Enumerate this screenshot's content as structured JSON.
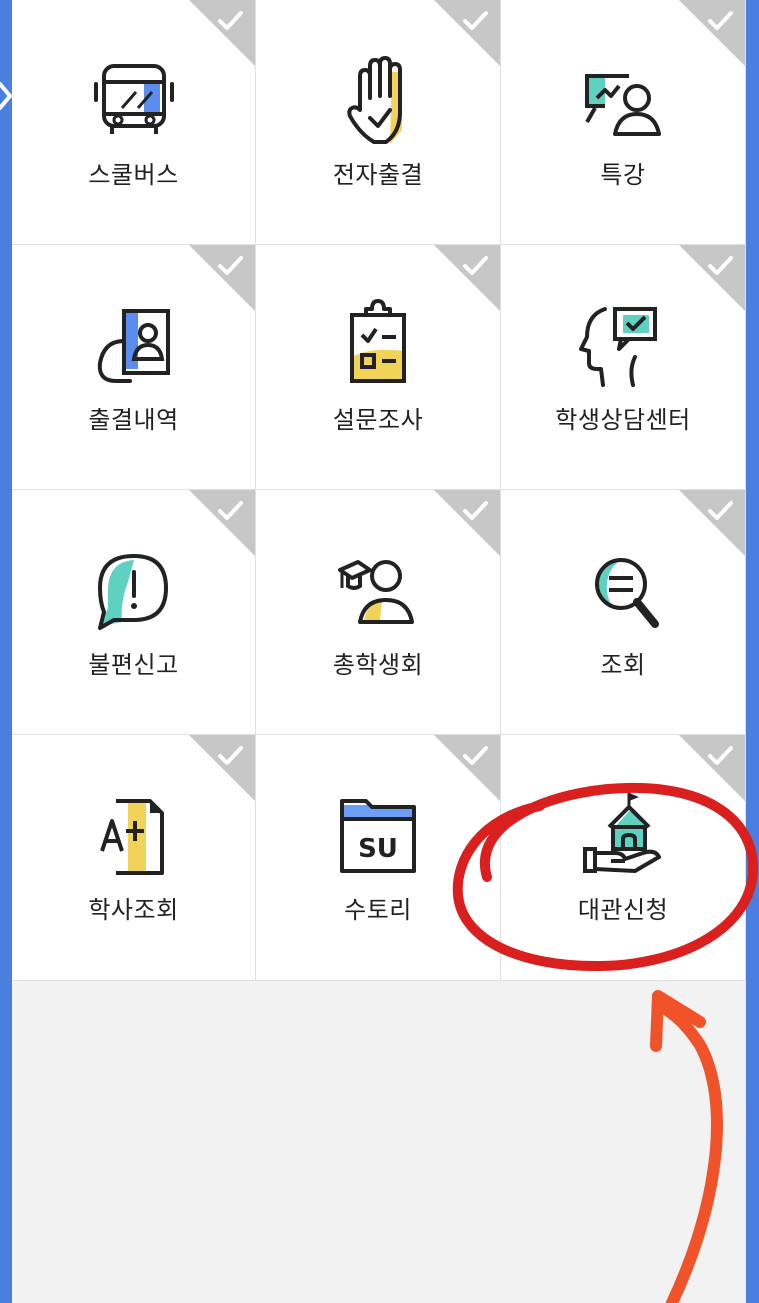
{
  "tiles": [
    {
      "label": "스쿨버스",
      "icon": "school-bus-icon"
    },
    {
      "label": "전자출결",
      "icon": "raised-hand-icon"
    },
    {
      "label": "특강",
      "icon": "lecture-icon"
    },
    {
      "label": "출결내역",
      "icon": "attendance-card-icon"
    },
    {
      "label": "설문조사",
      "icon": "clipboard-survey-icon"
    },
    {
      "label": "학생상담센터",
      "icon": "counseling-head-icon"
    },
    {
      "label": "불편신고",
      "icon": "complaint-bubble-icon"
    },
    {
      "label": "총학생회",
      "icon": "student-council-icon"
    },
    {
      "label": "조회",
      "icon": "search-magnifier-icon"
    },
    {
      "label": "학사조회",
      "icon": "grade-document-icon"
    },
    {
      "label": "수토리",
      "icon": "su-folder-icon",
      "icon_text": "SU"
    },
    {
      "label": "대관신청",
      "icon": "venue-rental-icon"
    }
  ],
  "colors": {
    "background": "#4a7fe0",
    "accent_blue": "#5b8def",
    "accent_yellow": "#f2d35a",
    "accent_teal": "#5fd1c0",
    "annotation_red": "#d9201f",
    "annotation_orange": "#f0532a"
  }
}
